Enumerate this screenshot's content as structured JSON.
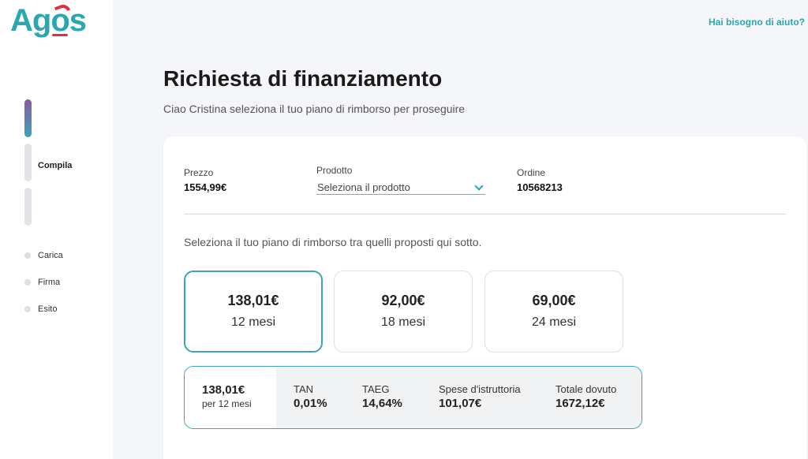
{
  "brand": {
    "logo_left": "Ag",
    "logo_o": "o",
    "logo_right": "s",
    "accent": "#2aa7b0",
    "mark": "#e3313c"
  },
  "header": {
    "help_link": "Hai bisogno di aiuto?"
  },
  "steps": {
    "current": "Compila",
    "others": [
      "Carica",
      "Firma",
      "Esito"
    ]
  },
  "page": {
    "title": "Richiesta di finanziamento",
    "subtitle": "Ciao Cristina seleziona il tuo piano di rimborso per proseguire"
  },
  "form": {
    "price_label": "Prezzo",
    "price_value": "1554,99€",
    "product_label": "Prodotto",
    "product_placeholder": "Seleziona il prodotto",
    "order_label": "Ordine",
    "order_value": "10568213"
  },
  "instructions": "Seleziona il tuo piano di rimborso tra quelli proposti qui sotto.",
  "plans": [
    {
      "amount": "138,01€",
      "months": "12 mesi",
      "selected": true
    },
    {
      "amount": "92,00€",
      "months": "18 mesi",
      "selected": false
    },
    {
      "amount": "69,00€",
      "months": "24 mesi",
      "selected": false
    }
  ],
  "summary": {
    "amount": "138,01€",
    "period": "per 12 mesi",
    "metrics": [
      {
        "label": "TAN",
        "value": "0,01%"
      },
      {
        "label": "TAEG",
        "value": "14,64%"
      },
      {
        "label": "Spese d'istruttoria",
        "value": "101,07€"
      },
      {
        "label": "Totale dovuto",
        "value": "1672,12€"
      }
    ]
  }
}
